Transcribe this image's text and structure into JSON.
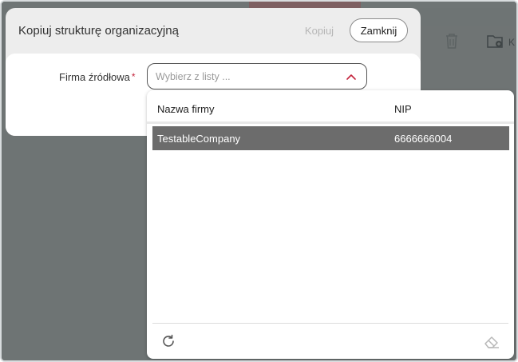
{
  "modal": {
    "title": "Kopiuj strukturę organizacyjną",
    "copy_label": "Kopiuj",
    "close_label": "Zamknij"
  },
  "form": {
    "source_label": "Firma źródłowa",
    "required_mark": "*",
    "select_placeholder": "Wybierz z listy ..."
  },
  "dropdown": {
    "columns": [
      "Nazwa firmy",
      "NIP"
    ],
    "rows": [
      {
        "name": "TestableCompany",
        "nip": "6666666004"
      }
    ]
  },
  "background": {
    "label_fragment": "K"
  },
  "colors": {
    "accent": "#c4243c",
    "selected_row": "#6c6c6c",
    "overlay": "#6e7474"
  },
  "icons": {
    "chevron": "chevron-up-icon",
    "refresh": "refresh-icon",
    "eraser": "eraser-icon",
    "trash": "trash-icon",
    "folder": "folder-add-icon"
  }
}
